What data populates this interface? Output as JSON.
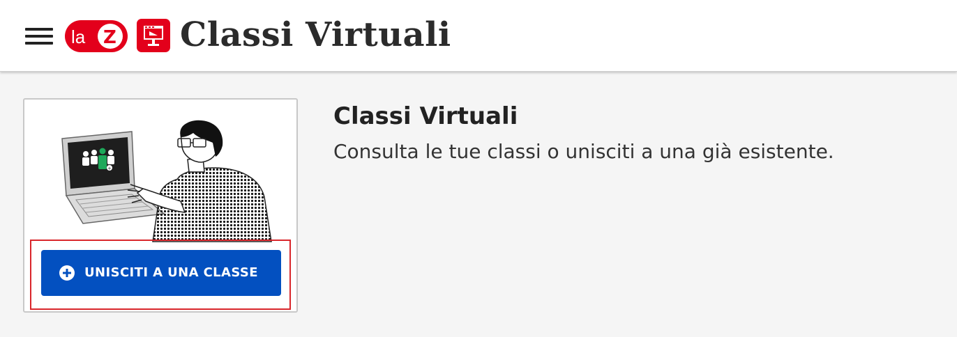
{
  "header": {
    "menu_icon": "hamburger-menu-icon",
    "brand_logo_text": "laZ",
    "app_icon": "virtual-classroom-icon",
    "title": "Classi Virtuali"
  },
  "main": {
    "card": {
      "illustration": "person-at-laptop-illustration",
      "join_button": {
        "label": "UNISCITI A UNA CLASSE",
        "icon": "plus-circle-icon"
      }
    },
    "section_title": "Classi Virtuali",
    "section_subtitle": "Consulta le tue classi o unisciti a una già esistente."
  },
  "colors": {
    "brand_red": "#e3001b",
    "button_blue": "#0350c0",
    "highlight_red": "#d9262b",
    "background": "#f5f5f5"
  }
}
